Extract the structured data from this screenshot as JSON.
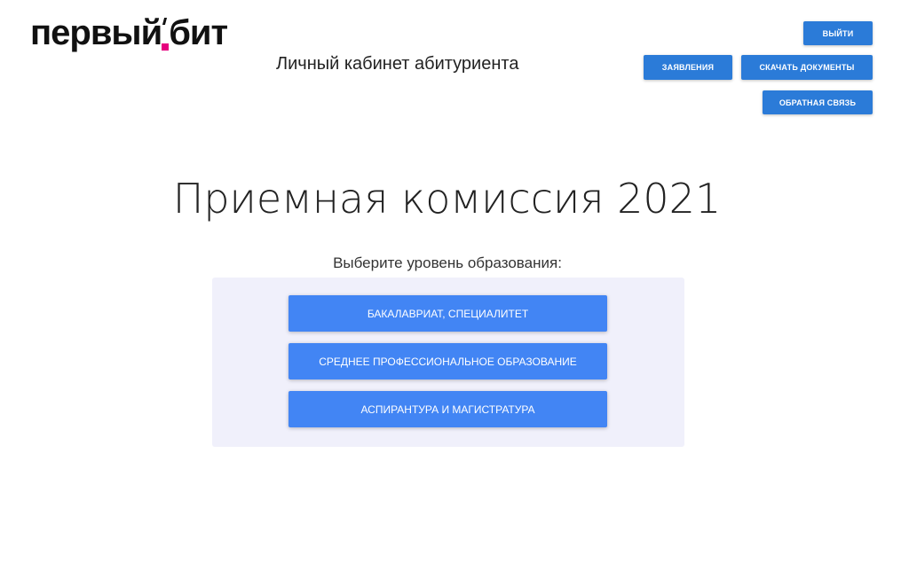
{
  "header": {
    "logo": {
      "part1": "первый",
      "part2": "бит"
    },
    "subtitle": "Личный кабинет абитуриента",
    "buttons": {
      "exit": "ВЫЙТИ",
      "applications": "ЗАЯВЛЕНИЯ",
      "download_documents": "СКАЧАТЬ ДОКУМЕНТЫ",
      "feedback": "ОБРАТНАЯ СВЯЗЬ"
    }
  },
  "main": {
    "title": "Приемная комиссия 2021",
    "choose_label": "Выберите уровень образования:",
    "levels": [
      {
        "label": "БАКАЛАВРИАТ, СПЕЦИАЛИТЕТ"
      },
      {
        "label": "СРЕДНЕЕ ПРОФЕССИОНАЛЬНОЕ ОБРАЗОВАНИЕ"
      },
      {
        "label": "АСПИРАНТУРА И МАГИСТРАТУРА"
      }
    ]
  },
  "colors": {
    "header_button": "#2b7bd8",
    "level_button": "#4285f4",
    "panel_background": "#f0f0fb",
    "logo_accent": "#e6007e"
  }
}
